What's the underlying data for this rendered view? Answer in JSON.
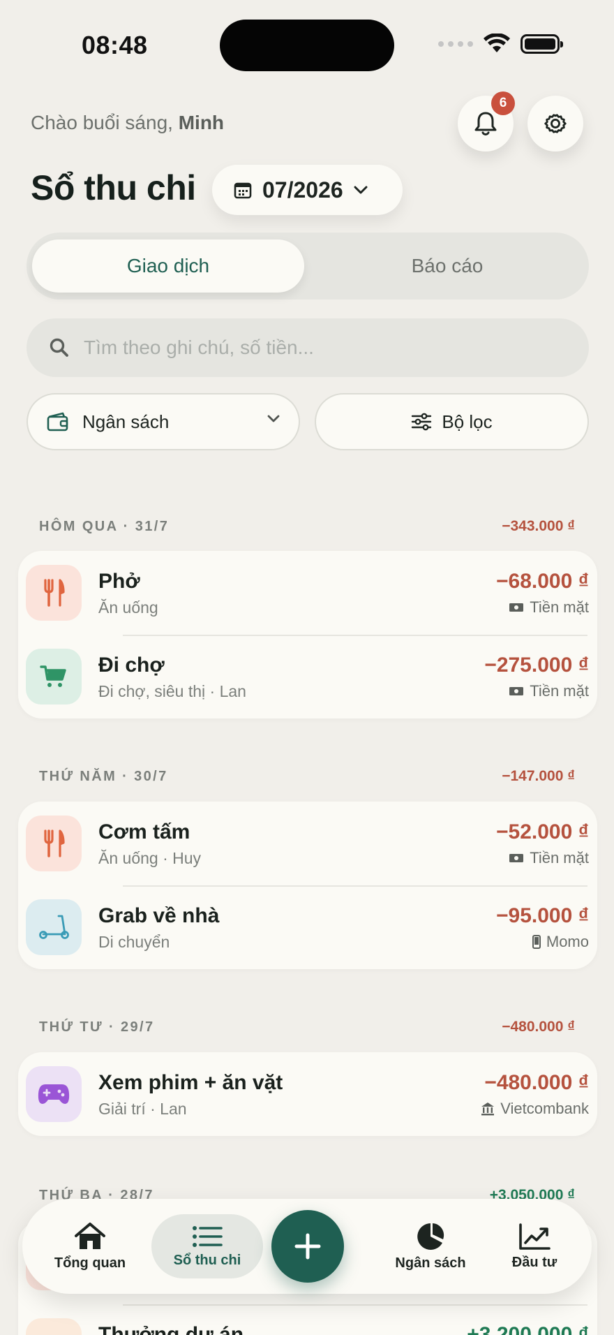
{
  "status_bar": {
    "time": "08:48"
  },
  "header": {
    "greeting_prefix": "Chào buổi sáng,",
    "user_name": "Minh",
    "notification_count": "6",
    "title": "Sổ thu chi",
    "month": "07/2026"
  },
  "tabs": {
    "left": "Giao dịch",
    "right": "Báo cáo"
  },
  "search": {
    "placeholder": "Tìm theo ghi chú, số tiền..."
  },
  "filters": {
    "budget_label": "Ngân sách",
    "filter_label": "Bộ lọc"
  },
  "sections": [
    {
      "label": "HÔM QUA · 31/7",
      "total": "−343.000 ₫",
      "rows": [
        {
          "icon": "fork-knife-icon",
          "title": "Phở",
          "subtitle": "Ăn uống",
          "amount": "−68.000 ₫",
          "source": "Tiền mặt",
          "source_icon": "cash-icon"
        },
        {
          "icon": "cart-icon",
          "title": "Đi chợ",
          "subtitle": "Đi chợ, siêu thị · Lan",
          "amount": "−275.000 ₫",
          "source": "Tiền mặt",
          "source_icon": "cash-icon"
        }
      ]
    },
    {
      "label": "THỨ NĂM · 30/7",
      "total": "−147.000 ₫",
      "rows": [
        {
          "icon": "fork-knife-icon",
          "title": "Cơm tấm",
          "subtitle": "Ăn uống · Huy",
          "amount": "−52.000 ₫",
          "source": "Tiền mặt",
          "source_icon": "cash-icon"
        },
        {
          "icon": "scooter-icon",
          "title": "Grab về nhà",
          "subtitle": "Di chuyển",
          "amount": "−95.000 ₫",
          "source": "Momo",
          "source_icon": "phone-icon"
        }
      ]
    },
    {
      "label": "THỨ TƯ · 29/7",
      "total": "−480.000 ₫",
      "rows": [
        {
          "icon": "gamepad-icon",
          "title": "Xem phim + ăn vặt",
          "subtitle": "Giải trí · Lan",
          "amount": "−480.000 ₫",
          "source": "Vietcombank",
          "source_icon": "bank-icon"
        }
      ]
    },
    {
      "label": "THỨ BA · 28/7",
      "total": "+3.050.000 ₫",
      "rows": [
        {
          "icon": "fork-knife-icon",
          "title": "",
          "subtitle": "",
          "amount": "",
          "source": "",
          "source_icon": "cash-icon"
        },
        {
          "icon": "star-icon",
          "title": "Thưởng dự án",
          "subtitle": "",
          "amount": "+3.200.000 ₫",
          "source": "",
          "source_icon": ""
        }
      ]
    }
  ],
  "bottom_nav": [
    {
      "label": "Tổng quan",
      "icon": "home-icon"
    },
    {
      "label": "Sổ thu chi",
      "icon": "list-icon",
      "active": true
    },
    {
      "label": "Ngân sách",
      "icon": "pie-chart-icon"
    },
    {
      "label": "Đầu tư",
      "icon": "trend-chart-icon"
    }
  ],
  "colors": {
    "accent": "#1f5f52",
    "expense": "#b5523e",
    "income": "#1f7a54",
    "background": "#f1efea",
    "card": "#fbfaf5"
  }
}
